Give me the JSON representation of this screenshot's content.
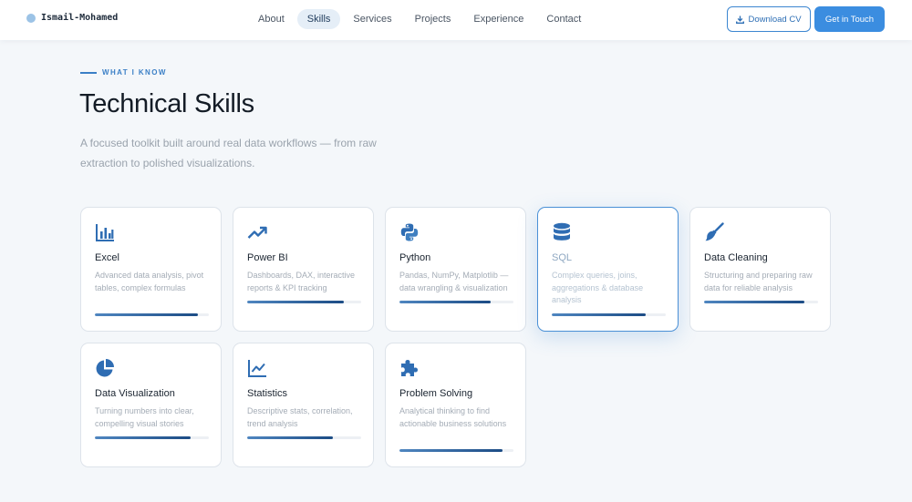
{
  "brand": {
    "name": "Ismail-Mohamed"
  },
  "nav": {
    "links": [
      "About",
      "Skills",
      "Services",
      "Projects",
      "Experience",
      "Contact"
    ],
    "active_index": 1,
    "download_cv": "Download CV",
    "get_in_touch": "Get in Touch"
  },
  "hero": {
    "eyebrow": "WHAT I KNOW",
    "title": "Technical Skills",
    "subtitle": "A focused toolkit built around real data workflows — from raw extraction to polished visualizations."
  },
  "skills": [
    {
      "icon": "bar-chart-icon",
      "title": "Excel",
      "desc": "Advanced data analysis, pivot tables, complex formulas",
      "level": 0.9
    },
    {
      "icon": "trend-arrow-icon",
      "title": "Power BI",
      "desc": "Dashboards, DAX, interactive reports & KPI tracking",
      "level": 0.85
    },
    {
      "icon": "python-icon",
      "title": "Python",
      "desc": "Pandas, NumPy, Matplotlib — data wrangling & visualization",
      "level": 0.8
    },
    {
      "icon": "database-icon",
      "title": "SQL",
      "desc": "Complex queries, joins, aggregations & database analysis",
      "level": 0.82,
      "highlight": true
    },
    {
      "icon": "broom-icon",
      "title": "Data Cleaning",
      "desc": "Structuring and preparing raw data for reliable analysis",
      "level": 0.88
    },
    {
      "icon": "pie-chart-icon",
      "title": "Data Visualization",
      "desc": "Turning numbers into clear, compelling visual stories",
      "level": 0.84
    },
    {
      "icon": "line-chart-icon",
      "title": "Statistics",
      "desc": "Descriptive stats, correlation, trend analysis",
      "level": 0.75
    },
    {
      "icon": "puzzle-icon",
      "title": "Problem Solving",
      "desc": "Analytical thinking to find actionable business solutions",
      "level": 0.9
    }
  ],
  "colors": {
    "accent": "#3b8de0",
    "icon": "#2f6db3",
    "bar_start": "#4f86c0",
    "bar_end": "#1c4c85"
  }
}
